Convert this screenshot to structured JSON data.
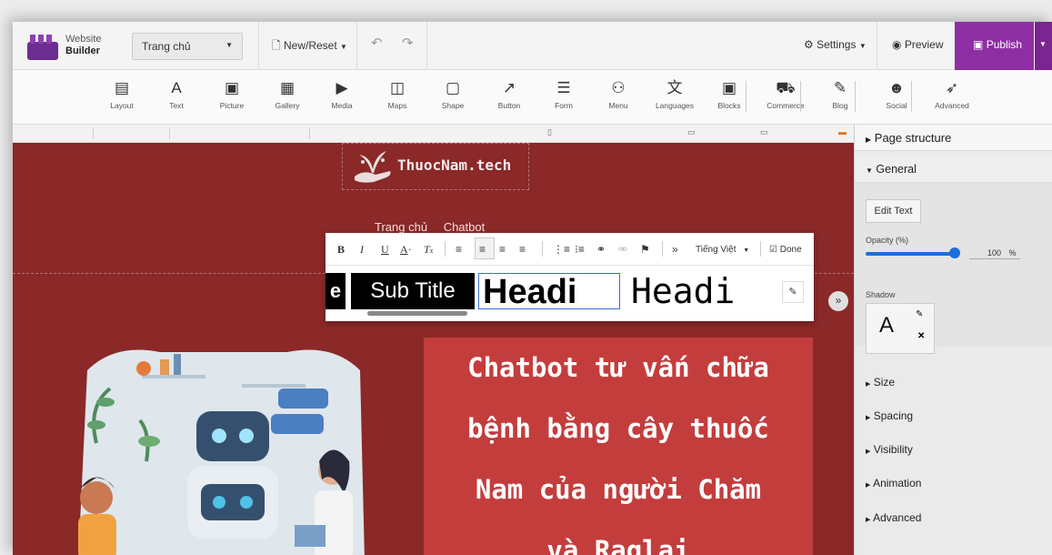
{
  "app": {
    "brand_line1": "Website",
    "brand_line2": "Builder",
    "page_select": "Trang chủ",
    "new_reset": "New/Reset",
    "settings": "Settings",
    "preview": "Preview",
    "publish": "Publish",
    "accent_color": "#8e2ea3"
  },
  "components": [
    {
      "icon": "layout-icon",
      "glyph": "▤",
      "label": "Layout"
    },
    {
      "icon": "text-icon",
      "glyph": "A",
      "label": "Text"
    },
    {
      "icon": "picture-icon",
      "glyph": "▣",
      "label": "Picture"
    },
    {
      "icon": "gallery-icon",
      "glyph": "▦",
      "label": "Gallery"
    },
    {
      "icon": "media-icon",
      "glyph": "▶",
      "label": "Media"
    },
    {
      "icon": "maps-icon",
      "glyph": "◫",
      "label": "Maps"
    },
    {
      "icon": "shape-icon",
      "glyph": "▢",
      "label": "Shape"
    },
    {
      "icon": "button-icon",
      "glyph": "↗",
      "label": "Button"
    },
    {
      "icon": "form-icon",
      "glyph": "☰",
      "label": "Form"
    },
    {
      "icon": "menu-icon",
      "glyph": "⚇",
      "label": "Menu"
    },
    {
      "icon": "languages-icon",
      "glyph": "文",
      "label": "Languages"
    },
    {
      "icon": "blocks-icon",
      "glyph": "▣",
      "label": "Blocks"
    },
    {
      "icon": "commerce-icon",
      "glyph": "⛟",
      "label": "Commerce"
    },
    {
      "icon": "blog-icon",
      "glyph": "✎",
      "label": "Blog"
    },
    {
      "icon": "social-icon",
      "glyph": "☻",
      "label": "Social"
    },
    {
      "icon": "advanced-icon",
      "glyph": "➶",
      "label": "Advanced"
    }
  ],
  "site": {
    "logo_text": "ThuocNam.tech",
    "nav": [
      "Trang chủ",
      "Chatbot"
    ],
    "hero_lines": [
      "Chatbot tư vấn chữa",
      "bệnh bằng cây thuốc",
      "Nam của người Chăm",
      "và Raglai"
    ],
    "bg_color": "#8b2828",
    "hero_color": "#c43d3d"
  },
  "editor": {
    "language": "Tiếng Việt",
    "done": "Done",
    "styles": [
      "e",
      "Sub Title",
      "Headi",
      "Headi"
    ]
  },
  "panel": {
    "page_structure": "Page structure",
    "general": "General",
    "edit_text": "Edit Text",
    "opacity_label": "Opacity (%)",
    "opacity_value": "100",
    "opacity_unit": "%",
    "shadow_label": "Shadow",
    "shadow_preview": "A",
    "sections": [
      "Size",
      "Spacing",
      "Visibility",
      "Animation",
      "Advanced"
    ]
  }
}
